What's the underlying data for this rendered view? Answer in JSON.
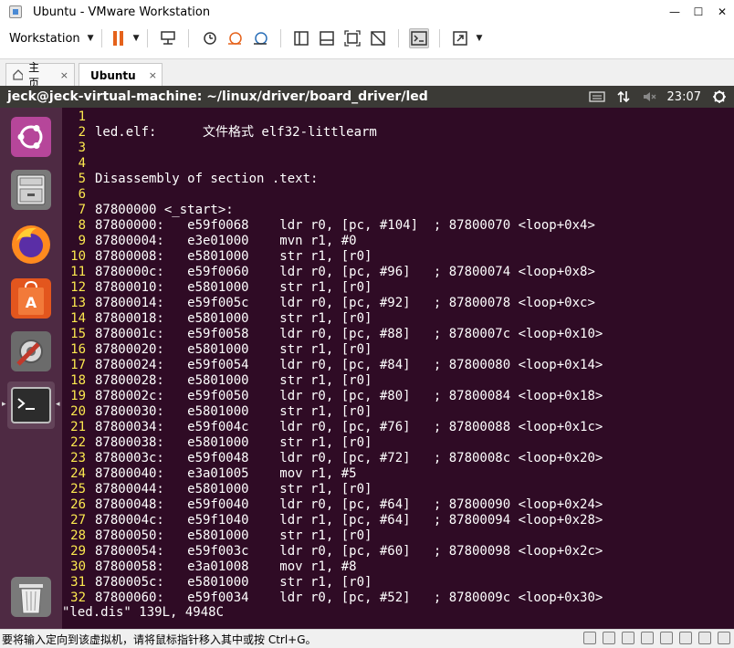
{
  "window": {
    "title": "Ubuntu - VMware Workstation",
    "minimize": "—",
    "maximize": "☐",
    "close": "✕"
  },
  "toolbar": {
    "workstation_label": "Workstation"
  },
  "tabs": [
    {
      "label": "主页",
      "close": "×"
    },
    {
      "label": "Ubuntu",
      "close": "×"
    }
  ],
  "vm": {
    "title": "jeck@jeck-virtual-machine: ~/linux/driver/board_driver/led",
    "time": "23:07"
  },
  "launcher": {
    "items": [
      "ubuntu-logo",
      "files",
      "firefox",
      "software-center",
      "system-settings",
      "terminal",
      "trash"
    ]
  },
  "terminal": {
    "lines": [
      {
        "n": "1",
        "t": ""
      },
      {
        "n": "2",
        "t": "led.elf:      文件格式 elf32-littlearm"
      },
      {
        "n": "3",
        "t": ""
      },
      {
        "n": "4",
        "t": ""
      },
      {
        "n": "5",
        "t": "Disassembly of section .text:"
      },
      {
        "n": "6",
        "t": ""
      },
      {
        "n": "7",
        "t": "87800000 <_start>:"
      },
      {
        "n": "8",
        "t": "87800000:   e59f0068    ldr r0, [pc, #104]  ; 87800070 <loop+0x4>"
      },
      {
        "n": "9",
        "t": "87800004:   e3e01000    mvn r1, #0"
      },
      {
        "n": "10",
        "t": "87800008:   e5801000    str r1, [r0]"
      },
      {
        "n": "11",
        "t": "8780000c:   e59f0060    ldr r0, [pc, #96]   ; 87800074 <loop+0x8>"
      },
      {
        "n": "12",
        "t": "87800010:   e5801000    str r1, [r0]"
      },
      {
        "n": "13",
        "t": "87800014:   e59f005c    ldr r0, [pc, #92]   ; 87800078 <loop+0xc>"
      },
      {
        "n": "14",
        "t": "87800018:   e5801000    str r1, [r0]"
      },
      {
        "n": "15",
        "t": "8780001c:   e59f0058    ldr r0, [pc, #88]   ; 8780007c <loop+0x10>"
      },
      {
        "n": "16",
        "t": "87800020:   e5801000    str r1, [r0]"
      },
      {
        "n": "17",
        "t": "87800024:   e59f0054    ldr r0, [pc, #84]   ; 87800080 <loop+0x14>"
      },
      {
        "n": "18",
        "t": "87800028:   e5801000    str r1, [r0]"
      },
      {
        "n": "19",
        "t": "8780002c:   e59f0050    ldr r0, [pc, #80]   ; 87800084 <loop+0x18>"
      },
      {
        "n": "20",
        "t": "87800030:   e5801000    str r1, [r0]"
      },
      {
        "n": "21",
        "t": "87800034:   e59f004c    ldr r0, [pc, #76]   ; 87800088 <loop+0x1c>"
      },
      {
        "n": "22",
        "t": "87800038:   e5801000    str r1, [r0]"
      },
      {
        "n": "23",
        "t": "8780003c:   e59f0048    ldr r0, [pc, #72]   ; 8780008c <loop+0x20>"
      },
      {
        "n": "24",
        "t": "87800040:   e3a01005    mov r1, #5"
      },
      {
        "n": "25",
        "t": "87800044:   e5801000    str r1, [r0]"
      },
      {
        "n": "26",
        "t": "87800048:   e59f0040    ldr r0, [pc, #64]   ; 87800090 <loop+0x24>"
      },
      {
        "n": "27",
        "t": "8780004c:   e59f1040    ldr r1, [pc, #64]   ; 87800094 <loop+0x28>"
      },
      {
        "n": "28",
        "t": "87800050:   e5801000    str r1, [r0]"
      },
      {
        "n": "29",
        "t": "87800054:   e59f003c    ldr r0, [pc, #60]   ; 87800098 <loop+0x2c>"
      },
      {
        "n": "30",
        "t": "87800058:   e3a01008    mov r1, #8"
      },
      {
        "n": "31",
        "t": "8780005c:   e5801000    str r1, [r0]"
      },
      {
        "n": "32",
        "t": "87800060:   e59f0034    ldr r0, [pc, #52]   ; 8780009c <loop+0x30>"
      }
    ],
    "status": "\"led.dis\" 139L, 4948C",
    "colors": {
      "background": "#2f0b25",
      "line_numbers": "#fce94f",
      "text": "#ffffff"
    }
  },
  "statusbar": {
    "message": "要将输入定向到该虚拟机，请将鼠标指针移入其中或按 Ctrl+G。"
  }
}
